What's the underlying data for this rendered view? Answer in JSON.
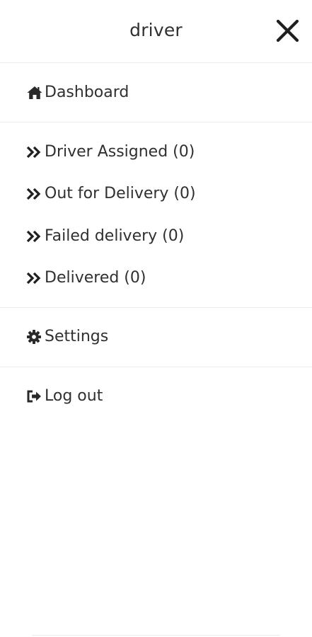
{
  "header": {
    "title": "driver",
    "close_icon": "close-icon"
  },
  "menu": {
    "dashboard": {
      "label": "Dashboard",
      "icon": "home-icon"
    },
    "statuses": [
      {
        "label": "Driver Assigned (0)",
        "icon": "double-chevron-right-icon"
      },
      {
        "label": "Out for Delivery (0)",
        "icon": "double-chevron-right-icon"
      },
      {
        "label": "Failed delivery (0)",
        "icon": "double-chevron-right-icon"
      },
      {
        "label": "Delivered (0)",
        "icon": "double-chevron-right-icon"
      }
    ],
    "settings": {
      "label": "Settings",
      "icon": "gear-icon"
    },
    "logout": {
      "label": "Log out",
      "icon": "logout-icon"
    }
  },
  "colors": {
    "text": "#303030",
    "divider": "#ececec",
    "background": "#ffffff"
  }
}
